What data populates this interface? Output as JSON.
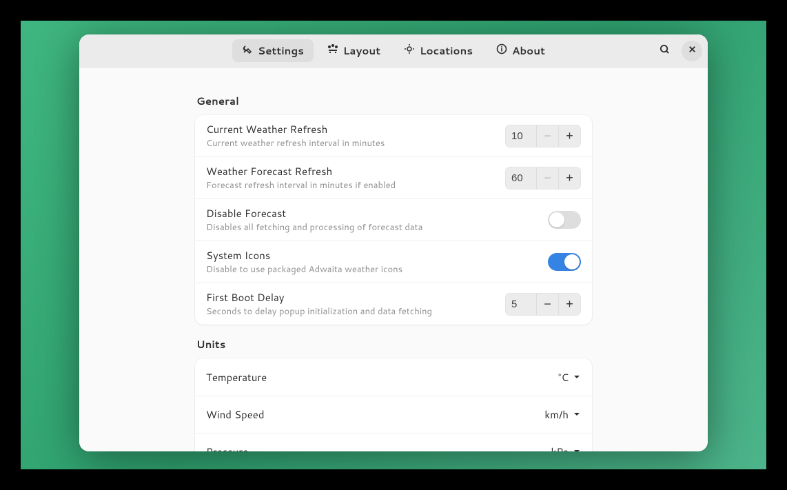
{
  "tabs": {
    "settings": "Settings",
    "layout": "Layout",
    "locations": "Locations",
    "about": "About"
  },
  "sections": {
    "general": {
      "title": "General",
      "current_refresh": {
        "title": "Current Weather Refresh",
        "sub": "Current weather refresh interval in minutes",
        "value": "10"
      },
      "forecast_refresh": {
        "title": "Weather Forecast Refresh",
        "sub": "Forecast refresh interval in minutes if enabled",
        "value": "60"
      },
      "disable_forecast": {
        "title": "Disable Forecast",
        "sub": "Disables all fetching and processing of forecast data"
      },
      "system_icons": {
        "title": "System Icons",
        "sub": "Disable to use packaged Adwaita weather icons"
      },
      "first_boot": {
        "title": "First Boot Delay",
        "sub": "Seconds to delay popup initialization and data fetching",
        "value": "5"
      }
    },
    "units": {
      "title": "Units",
      "temperature": {
        "title": "Temperature",
        "value": "°C"
      },
      "wind": {
        "title": "Wind Speed",
        "value": "km/h"
      },
      "pressure": {
        "title": "Pressure",
        "value": "kPa"
      }
    }
  }
}
